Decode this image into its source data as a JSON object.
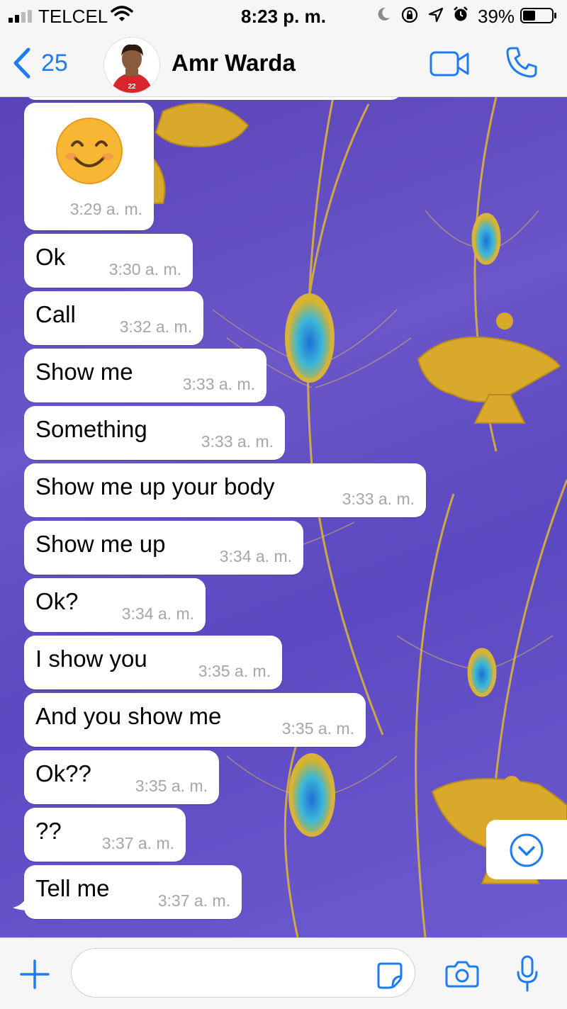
{
  "status_bar": {
    "carrier": "TELCEL",
    "time": "8:23 p. m.",
    "battery_percent": "39%",
    "icons": [
      "signal-icon",
      "wifi-icon",
      "moon-icon",
      "rotation-lock-icon",
      "location-icon",
      "alarm-icon",
      "battery-icon"
    ]
  },
  "header": {
    "back_count": "25",
    "contact_name": "Amr Warda",
    "avatar_jersey_number": "22"
  },
  "messages": [
    {
      "type": "emoji",
      "emoji": "😊",
      "time": "3:29 a. m."
    },
    {
      "text": "Ok",
      "time": "3:30 a. m."
    },
    {
      "text": "Call",
      "time": "3:32 a. m."
    },
    {
      "text": "Show me",
      "time": "3:33 a. m."
    },
    {
      "text": "Something",
      "time": "3:33 a. m."
    },
    {
      "text": "Show me up your body",
      "time": "3:33 a. m."
    },
    {
      "text": "Show me up",
      "time": "3:34 a. m."
    },
    {
      "text": "Ok?",
      "time": "3:34 a. m."
    },
    {
      "text": "I show you",
      "time": "3:35 a. m."
    },
    {
      "text": "And you show me",
      "time": "3:35 a. m."
    },
    {
      "text": "Ok??",
      "time": "3:35 a. m."
    },
    {
      "text": "??",
      "time": "3:37 a. m."
    },
    {
      "text": "Tell me",
      "time": "3:37 a. m."
    }
  ],
  "input": {
    "placeholder": "",
    "value": ""
  },
  "colors": {
    "accent": "#1e7cf2",
    "wallpaper": "#5c48c0",
    "bubble": "#ffffff",
    "timestamp": "#a6a6a6"
  }
}
